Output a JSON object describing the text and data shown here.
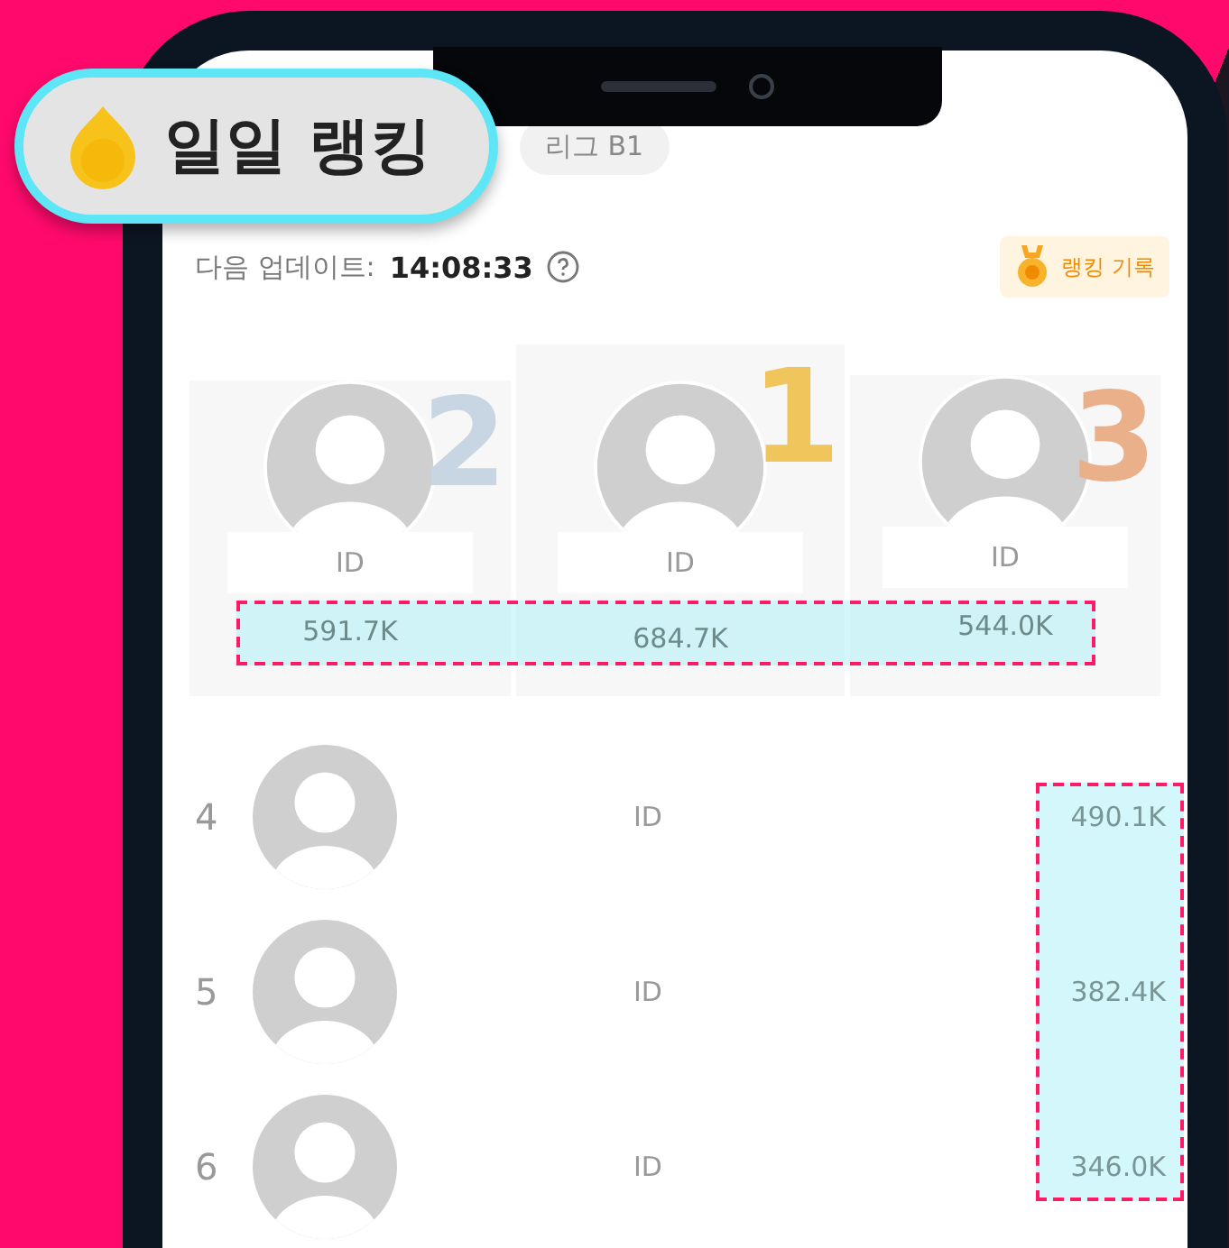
{
  "badge": {
    "title": "일일 랭킹"
  },
  "league": {
    "label": "리그 B1"
  },
  "update": {
    "label": "다음 업데이트:",
    "time": "14:08:33"
  },
  "history_button": {
    "label": "랭킹 기록"
  },
  "podium": [
    {
      "rank": "2",
      "id": "ID",
      "score": "591.7K",
      "color": "#c8d6e4"
    },
    {
      "rank": "1",
      "id": "ID",
      "score": "684.7K",
      "color": "#f0c55c"
    },
    {
      "rank": "3",
      "id": "ID",
      "score": "544.0K",
      "color": "#eab08a"
    }
  ],
  "list": [
    {
      "rank": "4",
      "id": "ID",
      "score": "490.1K"
    },
    {
      "rank": "5",
      "id": "ID",
      "score": "382.4K"
    },
    {
      "rank": "6",
      "id": "ID",
      "score": "346.0K"
    }
  ]
}
